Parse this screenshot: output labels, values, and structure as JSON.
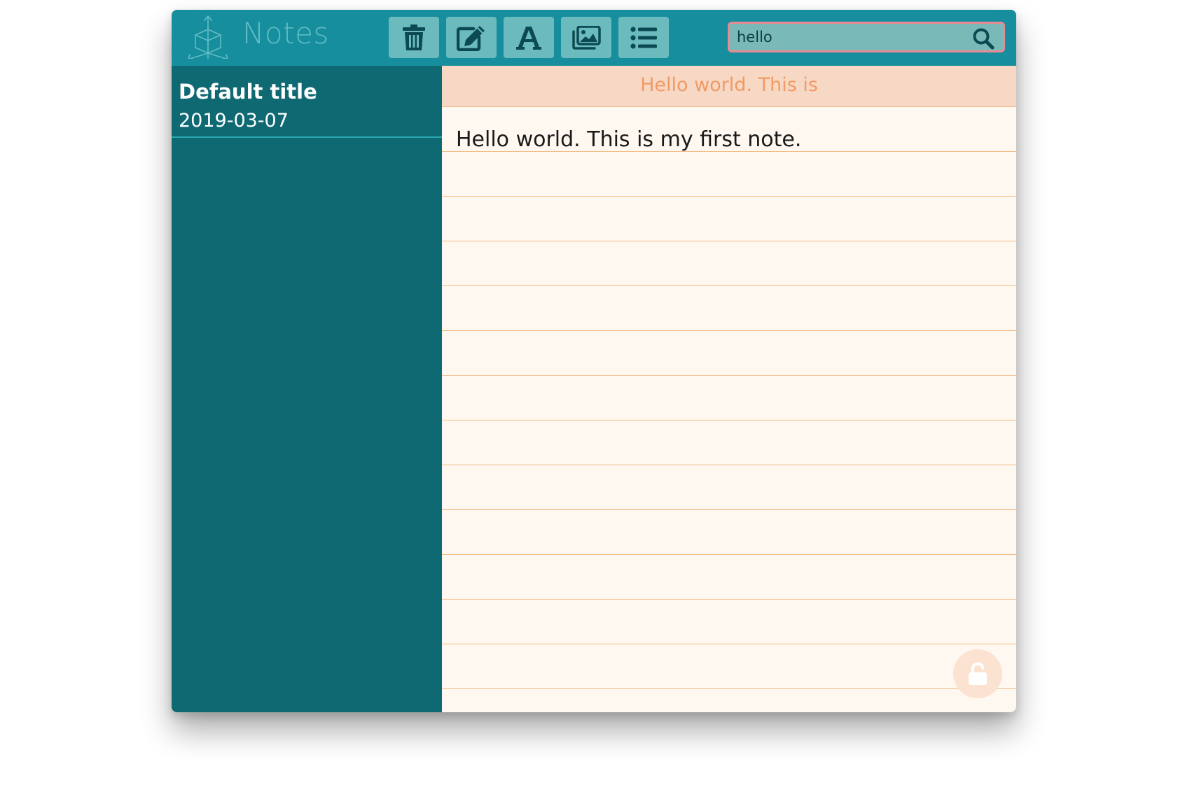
{
  "app": {
    "title": "Notes"
  },
  "toolbar": {
    "buttons": [
      {
        "name": "delete",
        "icon": "trash-icon"
      },
      {
        "name": "edit",
        "icon": "pencil-square-icon"
      },
      {
        "name": "font",
        "icon": "font-icon"
      },
      {
        "name": "image",
        "icon": "images-icon"
      },
      {
        "name": "list",
        "icon": "list-icon"
      }
    ]
  },
  "search": {
    "value": "hello",
    "icon": "search-icon"
  },
  "sidebar": {
    "notes": [
      {
        "title": "Default title",
        "date": "2019-03-07"
      }
    ]
  },
  "editor": {
    "preview": "Hello world. This is",
    "content": "Hello world. This is my first note.",
    "lock_icon": "unlock-icon"
  },
  "colors": {
    "header": "#178e9e",
    "sidebar": "#0f6973",
    "tool_button": "#6bbabd",
    "search_border": "#ea8a93",
    "editor_bg": "#fef8f1",
    "editor_head": "#f7d8c5",
    "rule_line": "#f4bb85"
  }
}
